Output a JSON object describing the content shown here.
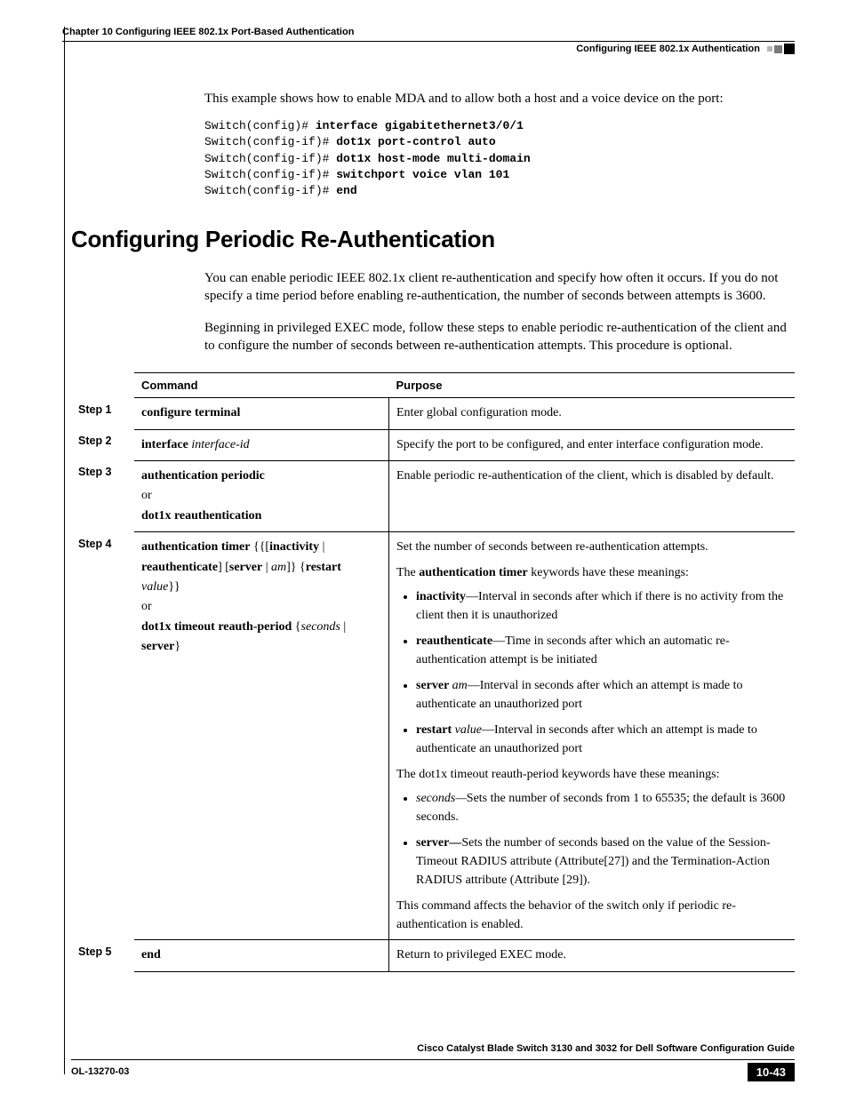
{
  "header": {
    "chapter": "Chapter 10      Configuring IEEE 802.1x Port-Based Authentication",
    "section_right": "Configuring IEEE 802.1x Authentication"
  },
  "intro_para": "This example shows how to enable MDA and to allow both a host and a voice device on the port:",
  "code": {
    "l1p": "Switch(config)# ",
    "l1b": "interface gigabitethernet3/0/1",
    "l2p": "Switch(config-if)# ",
    "l2b": "dot1x port-control auto",
    "l3p": "Switch(config-if)# ",
    "l3b": "dot1x host-mode multi-domain",
    "l4p": "Switch(config-if)# ",
    "l4b": "switchport voice vlan 101",
    "l5p": "Switch(config-if)# ",
    "l5b": "end"
  },
  "heading": "Configuring Periodic Re-Authentication",
  "para1": "You can enable periodic IEEE 802.1x client re-authentication and specify how often it occurs. If you do not specify a time period before enabling re-authentication, the number of seconds between attempts is 3600.",
  "para2": "Beginning in privileged EXEC mode, follow these steps to enable periodic re-authentication of the client and to configure the number of seconds between re-authentication attempts. This procedure is optional.",
  "table": {
    "headers": {
      "command": "Command",
      "purpose": "Purpose"
    },
    "steps": {
      "s1": "Step 1",
      "s2": "Step 2",
      "s3": "Step 3",
      "s4": "Step 4",
      "s5": "Step 5"
    },
    "row1": {
      "cmd_b": "configure terminal",
      "purpose": "Enter global configuration mode."
    },
    "row2": {
      "cmd_b": "interface ",
      "cmd_i": "interface-id",
      "purpose": "Specify the port to be configured, and enter interface configuration mode."
    },
    "row3": {
      "c1": "authentication periodic",
      "or": "or",
      "c2": "dot1x reauthentication",
      "purpose": "Enable periodic re-authentication of the client, which is disabled by default."
    },
    "row4": {
      "c_a": "authentication timer",
      "c_b1": " {{[",
      "c_b2": "inactivity",
      "c_b3": " | ",
      "c_b4": "reauthenticate",
      "c_b5": "] [",
      "c_b6": "server",
      "c_b7": " | ",
      "c_b8": "am",
      "c_b9": "]} {",
      "c_b10": "restart ",
      "c_b11": "value",
      "c_b12": "}}",
      "or": "or",
      "c_d1": "dot1x timeout reauth-period",
      "c_d2": " {",
      "c_d3": "seconds",
      "c_d4": " | ",
      "c_d5": "server",
      "c_d6": "}",
      "p_intro": "Set the number of seconds between re-authentication attempts.",
      "p_sub1a": "The ",
      "p_sub1b": "authentication timer",
      "p_sub1c": " keywords have these meanings:",
      "b1a": "inactivity",
      "b1b": "—Interval in seconds after which if there is no activity from the client then it is unauthorized",
      "b2a": "reauthenticate",
      "b2b": "—Time in seconds after which an automatic re-authentication attempt is be initiated",
      "b3a": "server ",
      "b3ai": "am",
      "b3b": "—Interval in seconds after which an attempt is made to authenticate an unauthorized port",
      "b4a": "restart ",
      "b4ai": "value",
      "b4b": "—Interval in seconds after which an attempt is made to authenticate an unauthorized port",
      "p_sub2": "The dot1x timeout reauth-period keywords have these meanings:",
      "b5a": "seconds—",
      "b5b": "Sets the number of seconds from 1 to 65535; the default is 3600 seconds.",
      "b6a": "server—",
      "b6b": "Sets the number of seconds based on the value of the Session-Timeout RADIUS attribute (Attribute[27]) and the Termination-Action RADIUS attribute (Attribute [29]).",
      "p_sub3": "This command affects the behavior of the switch only if periodic re-authentication is enabled."
    },
    "row5": {
      "cmd_b": "end",
      "purpose": "Return to privileged EXEC mode."
    }
  },
  "footer": {
    "book": "Cisco Catalyst Blade Switch 3130 and 3032 for Dell Software Configuration Guide",
    "docnum": "OL-13270-03",
    "pagenum": "10-43"
  }
}
